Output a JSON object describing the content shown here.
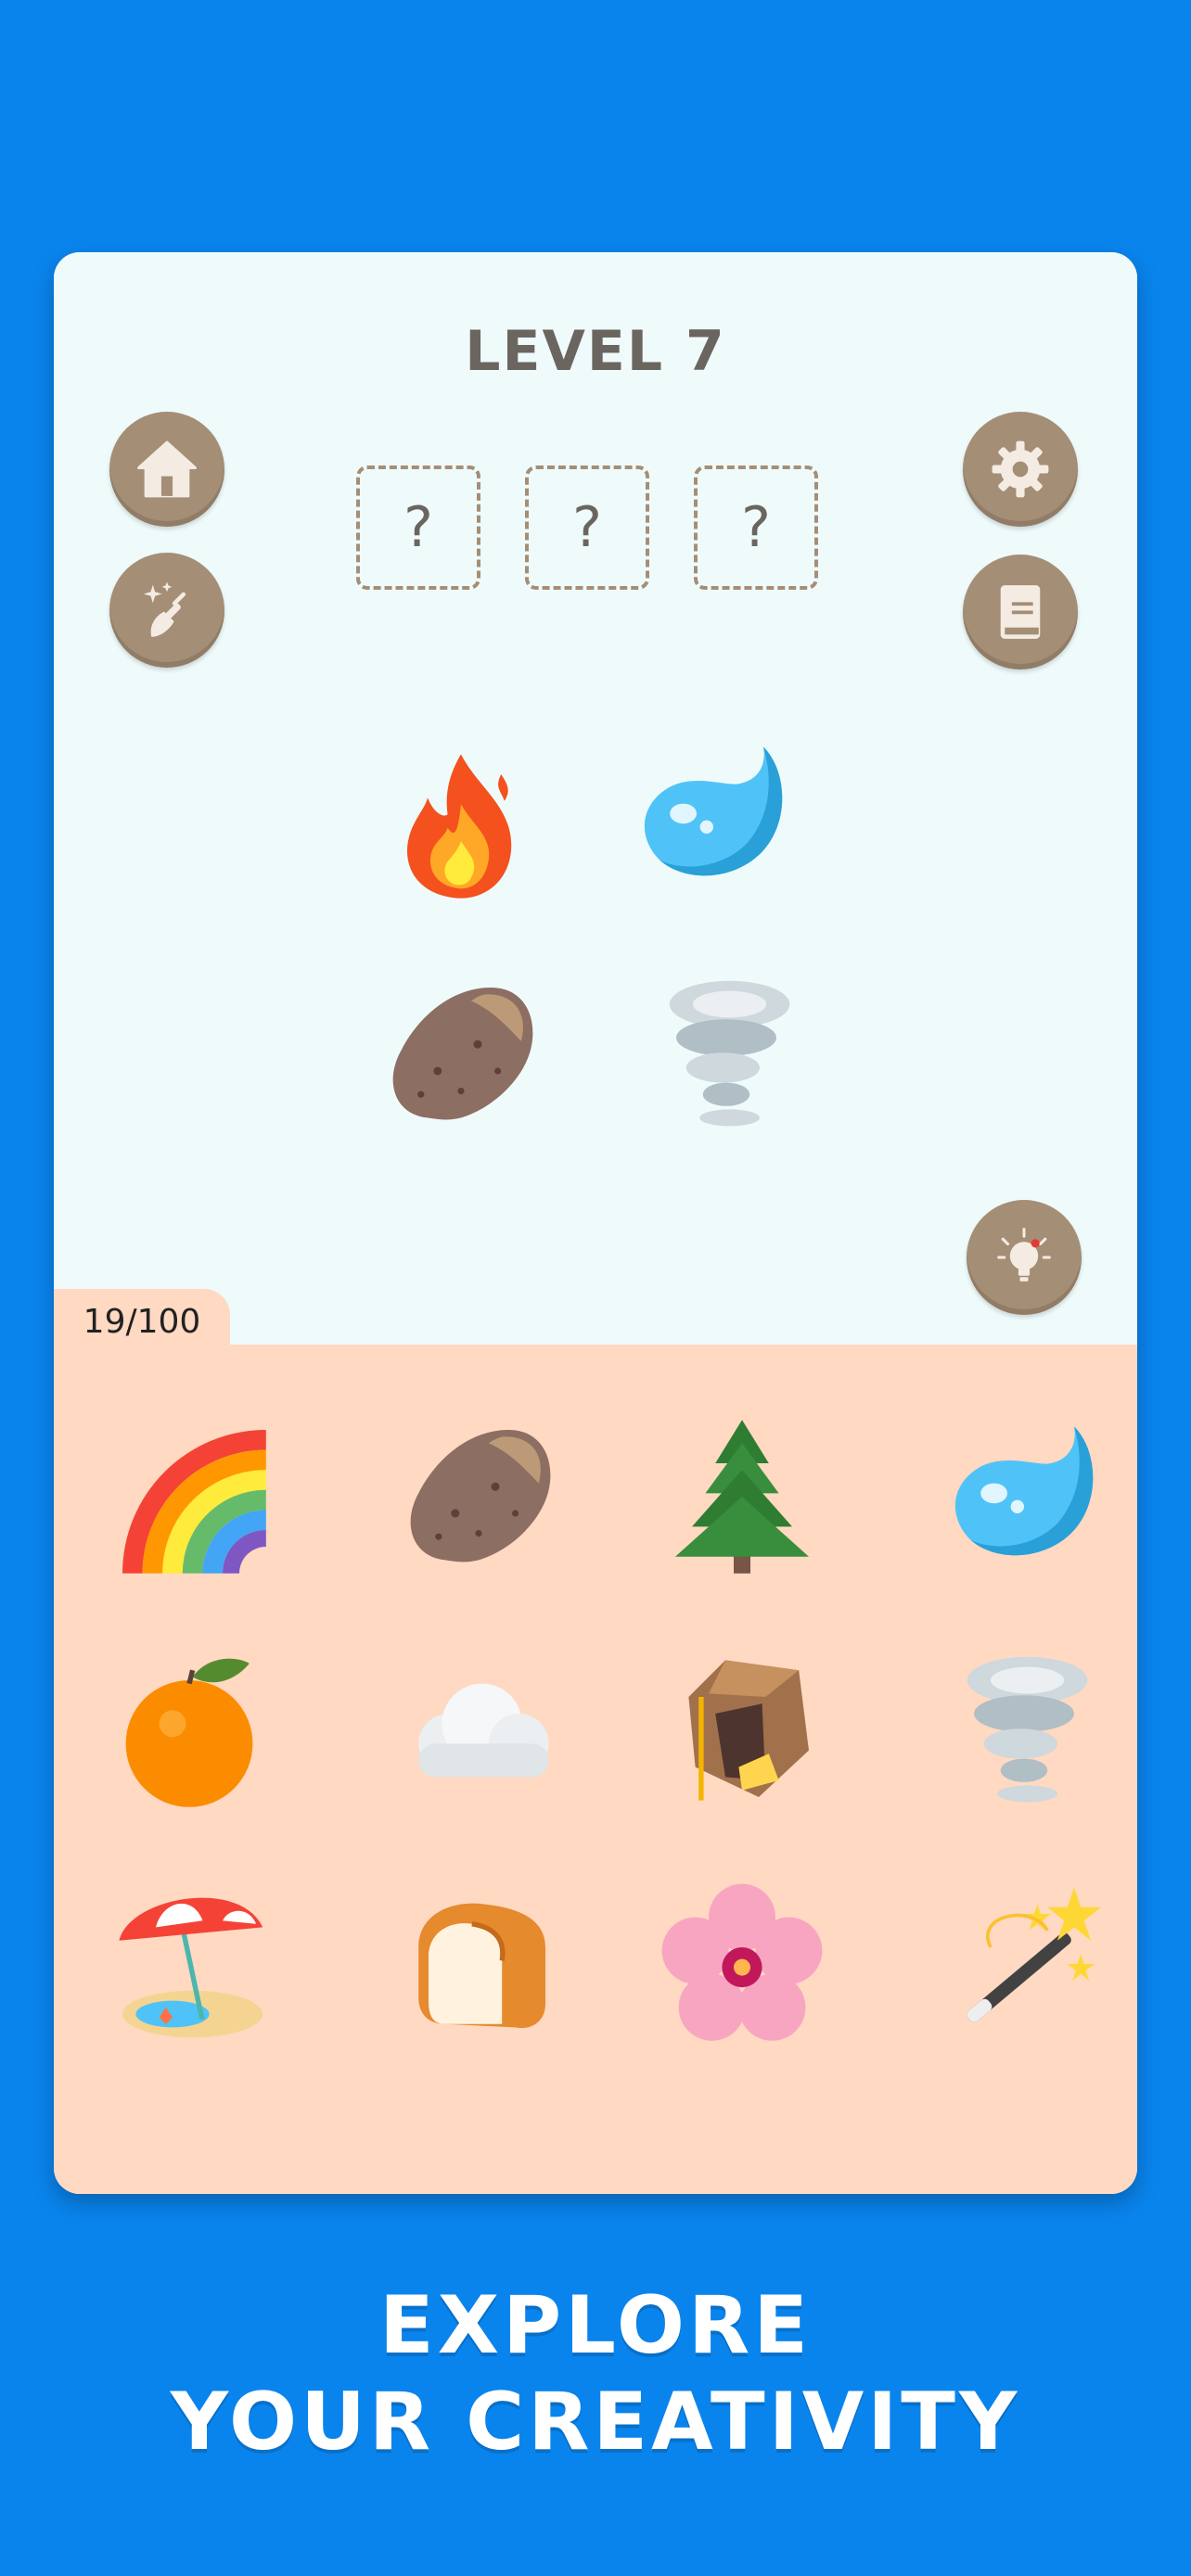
{
  "level": {
    "title": "LEVEL 7"
  },
  "slots": [
    "?",
    "?",
    "?"
  ],
  "buttons": {
    "home": "home-icon",
    "clean": "broom-sparkle-icon",
    "settings": "gear-icon",
    "recipe_book": "book-icon",
    "hint": "lightbulb-icon"
  },
  "board": [
    "fire",
    "water",
    "potato",
    "tornado"
  ],
  "counter": {
    "text": "19/100"
  },
  "inventory": [
    "rainbow",
    "potato",
    "evergreen-tree",
    "water",
    "tangerine",
    "cloud",
    "cave-with-cheese",
    "tornado",
    "beach-umbrella",
    "bread",
    "cherry-blossom",
    "magic-wand"
  ],
  "tagline": {
    "line1": "EXPLORE",
    "line2": "YOUR CREATIVITY"
  },
  "colors": {
    "background": "#0a84ed",
    "board_bg": "#effbfb",
    "inventory_bg": "#ffd9c2",
    "button": "#a58e76",
    "title_text": "#6b6560"
  }
}
